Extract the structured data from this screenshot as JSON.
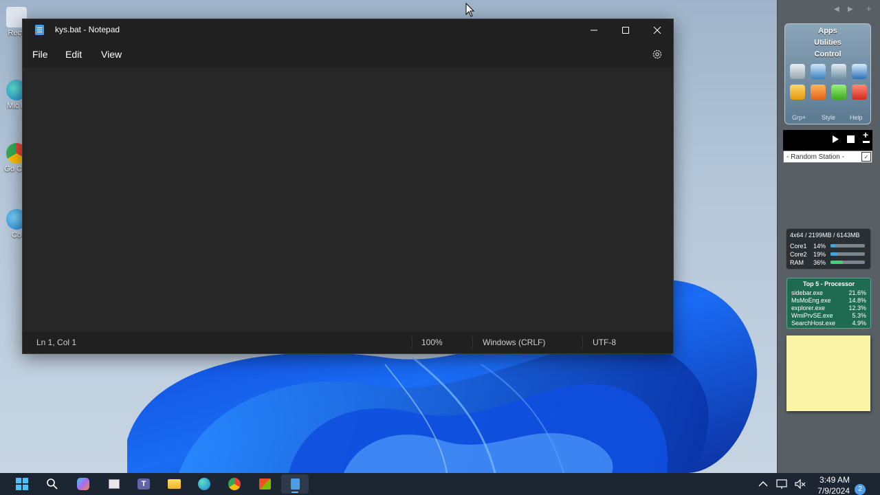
{
  "desktop": {
    "icons": [
      {
        "label": "Recy"
      },
      {
        "label": "Mic E"
      },
      {
        "label": "Go Chr"
      },
      {
        "label": "Co"
      }
    ]
  },
  "notepad": {
    "title": "kys.bat - Notepad",
    "menu": {
      "file": "File",
      "edit": "Edit",
      "view": "View"
    },
    "status": {
      "position": "Ln 1, Col 1",
      "zoom": "100%",
      "line_ending": "Windows (CRLF)",
      "encoding": "UTF-8"
    }
  },
  "sidebar": {
    "apps_gadget": {
      "titles": [
        "Apps",
        "Utilities",
        "Control"
      ],
      "footer": [
        "Grp+",
        "Style",
        "Help"
      ]
    },
    "radio": {
      "station": "- Random Station -"
    },
    "cpu_meter": {
      "header": "4x64 / 2199MB / 6143MB",
      "rows": [
        {
          "label": "Core1",
          "value": "14%",
          "fraction": 0.14,
          "color": "#3fa6e0"
        },
        {
          "label": "Core2",
          "value": "19%",
          "fraction": 0.19,
          "color": "#3fa6e0"
        },
        {
          "label": "RAM",
          "value": "36%",
          "fraction": 0.36,
          "color": "#41d17a"
        }
      ]
    },
    "top5": {
      "title": "Top 5 - Processor",
      "items": [
        {
          "name": "sidebar.exe",
          "value": "21.6%"
        },
        {
          "name": "MsMoEng.exe",
          "value": "14.8%"
        },
        {
          "name": "explorer.exe",
          "value": "12.3%"
        },
        {
          "name": "WmiPrvSE.exe",
          "value": "5.3%"
        },
        {
          "name": "SearchHost.exe",
          "value": "4.9%"
        }
      ]
    }
  },
  "taskbar": {
    "time": "3:49 AM",
    "date": "7/9/2024",
    "notifications": "2"
  }
}
